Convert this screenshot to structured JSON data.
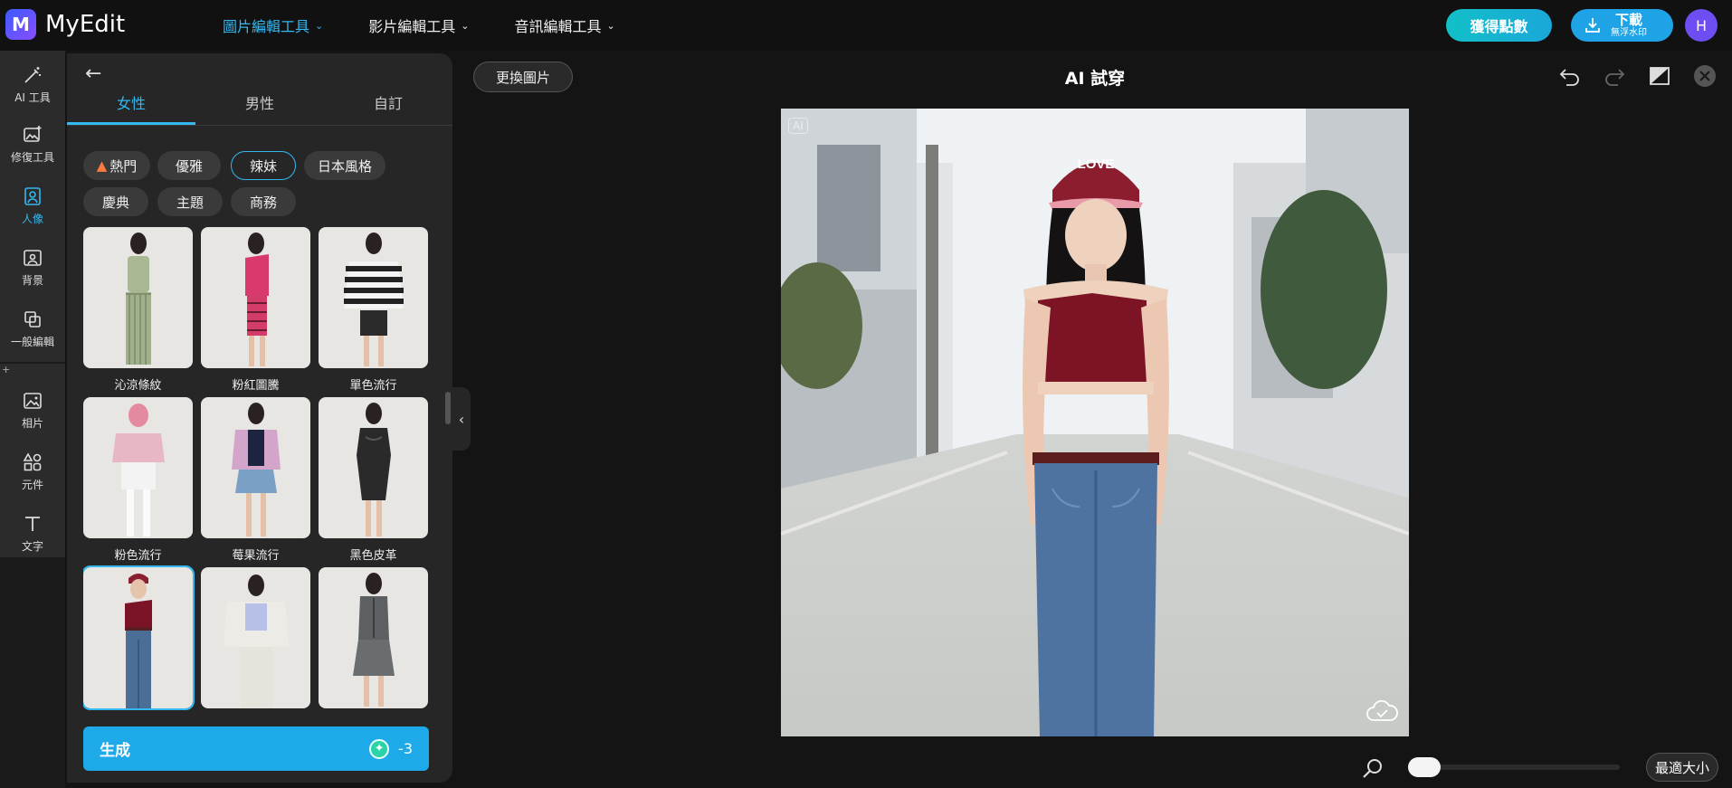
{
  "app": {
    "name": "MyEdit"
  },
  "nav": {
    "items": [
      {
        "label": "圖片編輯工具",
        "active": true
      },
      {
        "label": "影片編輯工具",
        "active": false
      },
      {
        "label": "音訊編輯工具",
        "active": false
      }
    ]
  },
  "header": {
    "points_label": "獲得點數",
    "download_label": "下載",
    "download_sub": "無浮水印",
    "avatar_initial": "H"
  },
  "sidebar": {
    "items": [
      {
        "label": "AI 工具",
        "icon": "magic-wand-icon"
      },
      {
        "label": "修復工具",
        "icon": "image-repair-icon"
      },
      {
        "label": "人像",
        "icon": "portrait-icon",
        "active": true
      },
      {
        "label": "背景",
        "icon": "background-icon"
      },
      {
        "label": "一般編輯",
        "icon": "crop-icon"
      },
      {
        "label": "相片",
        "icon": "photo-icon"
      },
      {
        "label": "元件",
        "icon": "shapes-icon"
      },
      {
        "label": "文字",
        "icon": "text-icon"
      }
    ]
  },
  "panel": {
    "tabs": [
      {
        "label": "女性",
        "active": true
      },
      {
        "label": "男性",
        "active": false
      },
      {
        "label": "自訂",
        "active": false
      }
    ],
    "chips": [
      {
        "label": "熱門",
        "icon": "fire-icon"
      },
      {
        "label": "優雅"
      },
      {
        "label": "辣妹",
        "active": true
      },
      {
        "label": "日本風格"
      },
      {
        "label": "慶典"
      },
      {
        "label": "主題"
      },
      {
        "label": "商務"
      }
    ],
    "styles": [
      {
        "label": "沁涼條紋"
      },
      {
        "label": "粉紅圖騰"
      },
      {
        "label": "單色流行"
      },
      {
        "label": "粉色流行"
      },
      {
        "label": "莓果流行"
      },
      {
        "label": "黑色皮革"
      },
      {
        "label": "",
        "selected": true
      },
      {
        "label": ""
      },
      {
        "label": ""
      }
    ],
    "generate_label": "生成",
    "generate_cost": "-3"
  },
  "editor": {
    "replace_label": "更換圖片",
    "title": "AI 試穿",
    "ai_badge": "AI",
    "cap_text": "LOVE",
    "fit_label": "最適大小"
  },
  "colors": {
    "accent": "#33b8f0",
    "points_gradient": "#12c0c8",
    "avatar": "#6e4ef2"
  }
}
